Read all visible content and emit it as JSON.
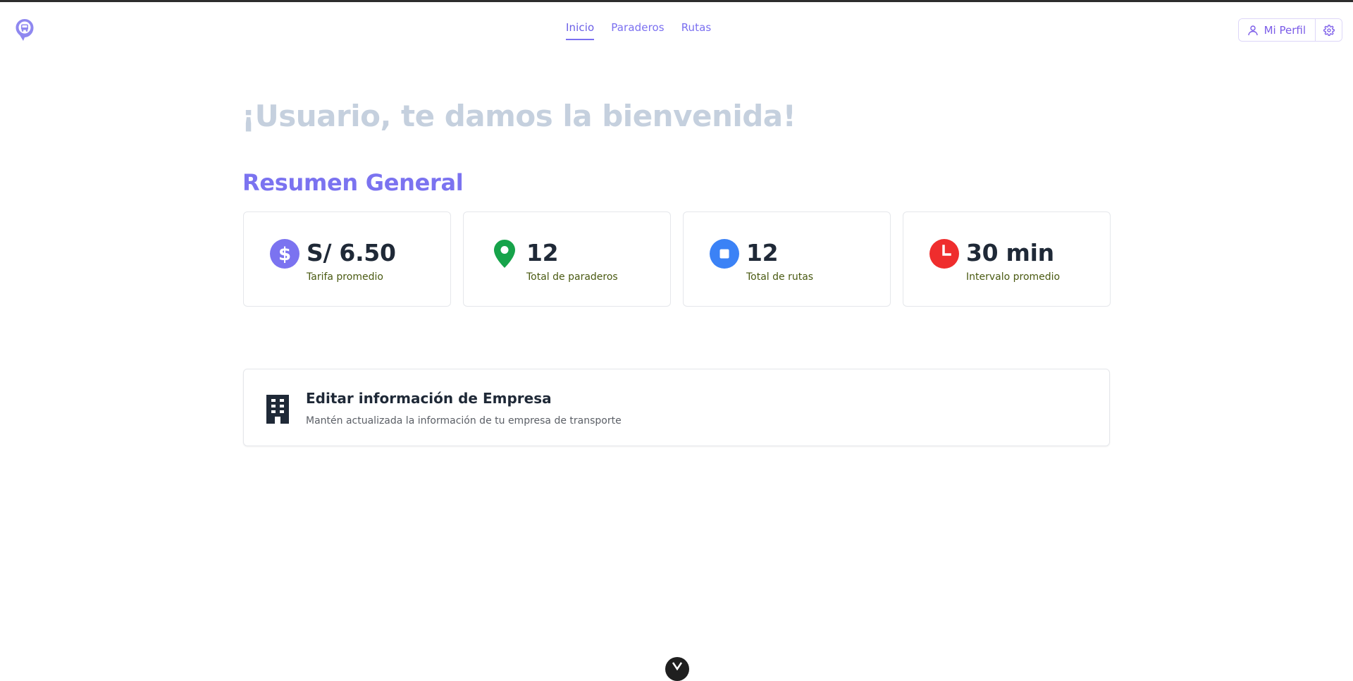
{
  "header": {
    "logo_icon": "bus-location-pin-icon",
    "nav": [
      {
        "label": "Inicio",
        "active": true
      },
      {
        "label": "Paraderos",
        "active": false
      },
      {
        "label": "Rutas",
        "active": false
      }
    ],
    "profile_label": "Mi Perfil",
    "profile_icon": "user-icon",
    "settings_icon": "gear-icon"
  },
  "main": {
    "welcome": "¡Usuario, te damos la bienvenida!",
    "section_title": "Resumen General",
    "stats": [
      {
        "value": "S/ 6.50",
        "label": "Tarifa promedio",
        "icon": "dollar-icon",
        "color": "#7b73f0"
      },
      {
        "value": "12",
        "label": "Total de paraderos",
        "icon": "map-pin-icon",
        "color": "#16a34a"
      },
      {
        "value": "12",
        "label": "Total de rutas",
        "icon": "stop-square-icon",
        "color": "#3b82f6"
      },
      {
        "value": "30 min",
        "label": "Intervalo promedio",
        "icon": "clock-icon",
        "color": "#ef2d2d"
      }
    ],
    "company": {
      "title": "Editar información de Empresa",
      "description": "Mantén actualizada la información de tu empresa de transporte",
      "icon": "building-icon"
    }
  },
  "colors": {
    "accent": "#7b73f0",
    "welcome_text": "#c5d0de"
  }
}
